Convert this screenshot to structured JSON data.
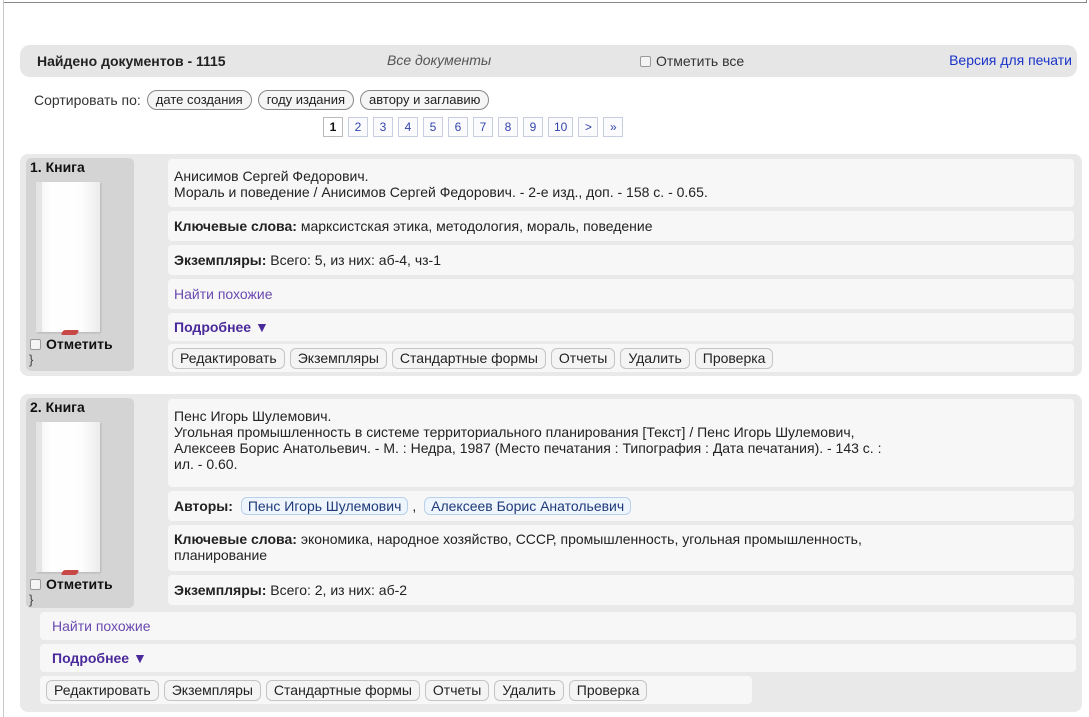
{
  "header": {
    "found_label": "Найдено документов - 1115",
    "all_documents": "Все документы",
    "mark_all": "Отметить все",
    "print_version": "Версия для печати"
  },
  "sort": {
    "label": "Сортировать по:",
    "options": [
      "дате создания",
      "году издания",
      "автору и заглавию"
    ]
  },
  "pagination": {
    "pages": [
      "1",
      "2",
      "3",
      "4",
      "5",
      "6",
      "7",
      "8",
      "9",
      "10",
      ">",
      "»"
    ],
    "current": "1"
  },
  "records": [
    {
      "number_type": "1. Книга",
      "mark_label": "Отметить",
      "squiggle": "}",
      "title_line1": "Анисимов Сергей Федорович.",
      "title_line2": "Мораль и поведение / Анисимов Сергей Федорович. - 2-е изд., доп. - 158 с. - 0.65.",
      "keywords_label": "Ключевые слова:",
      "keywords": "марксистская этика, методология, мораль, поведение",
      "copies_label": "Экземпляры:",
      "copies": "Всего: 5, из них: аб-4, чз-1",
      "find_similar": "Найти похожие",
      "more": "Подробнее ▼",
      "buttons": [
        "Редактировать",
        "Экземпляры",
        "Стандартные формы",
        "Отчеты",
        "Удалить",
        "Проверка"
      ]
    },
    {
      "number_type": "2. Книга",
      "mark_label": "Отметить",
      "squiggle": "}",
      "title_line1": "Пенс Игорь Шулемович.",
      "title_line2": "Угольная промышленность в системе территориального планирования [Текст] / Пенс Игорь Шулемович,",
      "title_line3": "Алексеев Борис Анатольевич. - М. : Недра, 1987 (Место печатания : Типография : Дата печатания). - 143 с. :",
      "title_line4": "ил. - 0.60.",
      "authors_label": "Авторы:",
      "authors": [
        "Пенс Игорь Шулемович",
        "Алексеев Борис Анатольевич"
      ],
      "authors_sep": ",",
      "keywords_label": "Ключевые слова:",
      "keywords_line1": "экономика, народное хозяйство, СССР, промышленность, угольная промышленность,",
      "keywords_line2": "планирование",
      "copies_label": "Экземпляры:",
      "copies": "Всего: 2, из них: аб-2",
      "find_similar": "Найти похожие",
      "more": "Подробнее ▼",
      "buttons": [
        "Редактировать",
        "Экземпляры",
        "Стандартные формы",
        "Отчеты",
        "Удалить",
        "Проверка"
      ]
    }
  ]
}
